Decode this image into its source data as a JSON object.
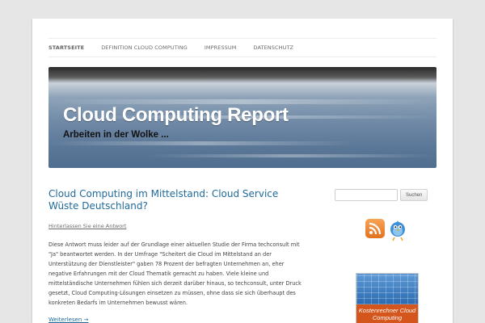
{
  "nav": {
    "items": [
      {
        "label": "Startseite",
        "active": true
      },
      {
        "label": "Definition Cloud Computing",
        "active": false
      },
      {
        "label": "Impressum",
        "active": false
      },
      {
        "label": "Datenschutz",
        "active": false
      }
    ]
  },
  "header": {
    "title": "Cloud Computing Report",
    "subtitle": "Arbeiten in der Wolke ..."
  },
  "post": {
    "title": "Cloud Computing im Mittelstand: Cloud Service Wüste Deutschland?",
    "comment_link": "Hinterlassen Sie eine Antwort",
    "body": "Diese Antwort muss leider auf der Grundlage einer aktuellen Studie der Firma techconsult mit \"Ja\" beantwortet werden. In der Umfrage \"Scheitert die Cloud im Mittelstand an der Unterstützung der Dienstleister\" gaben 78 Prozent der befragten Unternehmen an, eher negative Erfahrungen mit der Cloud Thematik gemacht zu haben. Viele kleine und mittelständische Unternehmen fühlen sich derzeit darüber hinaus, so techconsult, unter Druck gesetzt, Cloud Computing-Lösungen einsetzen zu müssen, ohne dass sie sich überhaupt des konkreten Bedarfs im Unternehmen bewusst wären.",
    "read_more": "Weiterlesen →"
  },
  "sidebar": {
    "search_value": "",
    "search_button": "Suchen",
    "rss_icon": "rss-feed-icon",
    "twitter_icon": "twitter-bird-icon",
    "badge_text": "Kostenrechner Cloud Computing"
  },
  "colors": {
    "link": "#1f6a9a",
    "background": "#e6e6e6",
    "badge_orange": "#d4561c"
  }
}
